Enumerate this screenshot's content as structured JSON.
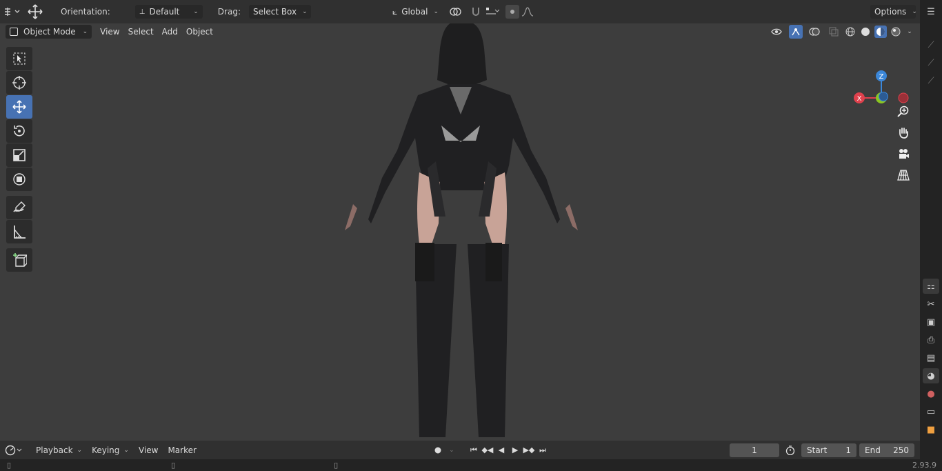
{
  "topbar": {
    "orientation_label": "Orientation:",
    "orientation_value": "Default",
    "drag_label": "Drag:",
    "drag_value": "Select Box",
    "transform_space": "Global",
    "options_label": "Options"
  },
  "viewport_header": {
    "mode": "Object Mode",
    "menus": [
      "View",
      "Select",
      "Add",
      "Object"
    ]
  },
  "gizmo": {
    "z": "Z",
    "y": "Y",
    "x": "X"
  },
  "timeline": {
    "menus": [
      "Playback",
      "Keying",
      "View",
      "Marker"
    ],
    "current_frame": "1",
    "start_label": "Start",
    "start_value": "1",
    "end_label": "End",
    "end_value": "250"
  },
  "statusbar": {
    "version": "2.93.9"
  },
  "colors": {
    "accent": "#4772b3",
    "axis_x": "#e0414d",
    "axis_y": "#8bc621",
    "axis_z": "#3b87d9",
    "viewport_bg": "#3d3d3d"
  }
}
